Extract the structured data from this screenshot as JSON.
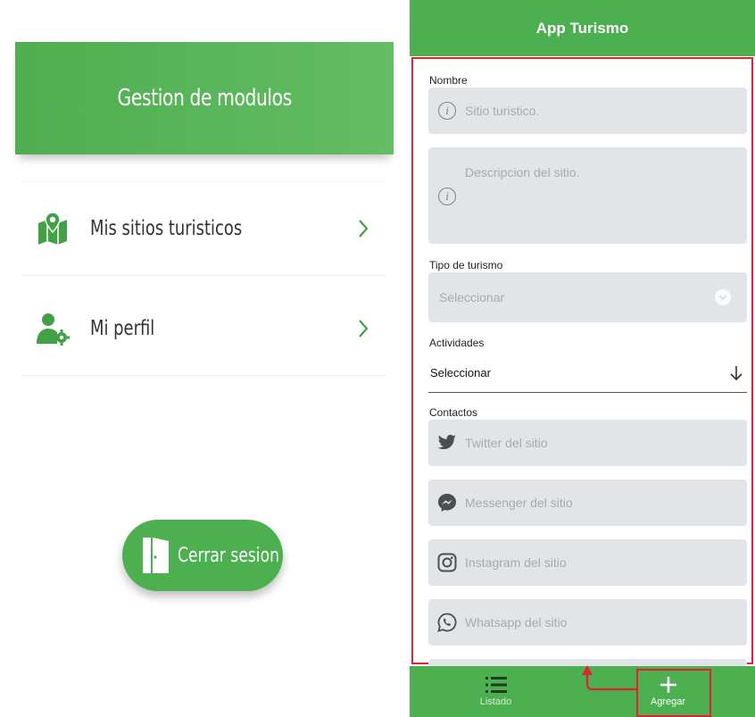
{
  "left": {
    "header_title": "Gestion de modulos",
    "menu": [
      {
        "label": "Mis sitios turisticos",
        "icon": "map-pin-icon"
      },
      {
        "label": "Mi perfil",
        "icon": "user-settings-icon"
      }
    ],
    "logout_label": "Cerrar sesion"
  },
  "right": {
    "app_title": "App Turismo",
    "form": {
      "name_label": "Nombre",
      "name_placeholder": "Sitio turistico.",
      "description_placeholder": "Descripcion del sitio.",
      "type_label": "Tipo de turismo",
      "type_placeholder": "Seleccionar",
      "activities_label": "Actividades",
      "activities_value": "Seleccionar",
      "contacts_label": "Contactos",
      "twitter_placeholder": "Twitter del sitio",
      "messenger_placeholder": "Messenger del sitio",
      "instagram_placeholder": "Instagram del sitio",
      "whatsapp_placeholder": "Whatsapp del sitio"
    },
    "nav": {
      "list_label": "Listado",
      "add_label": "Agregar"
    }
  },
  "colors": {
    "primary_green": "#4caf50",
    "icon_green": "#43a047",
    "highlight_red": "#e02234",
    "field_bg": "#e1e5e8"
  }
}
